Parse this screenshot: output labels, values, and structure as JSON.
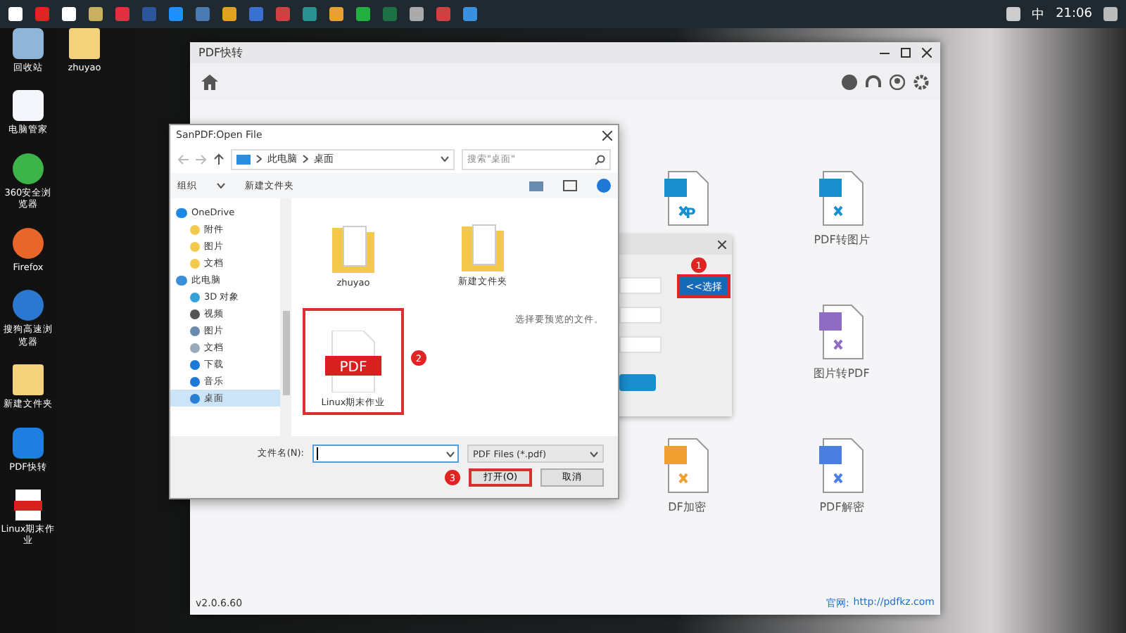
{
  "taskbar": {
    "ime": "中",
    "time": "21:06"
  },
  "desktop_icons": [
    {
      "label": "回收站",
      "kind": "bin"
    },
    {
      "label": "电脑管家",
      "kind": "app"
    },
    {
      "label": "360安全浏览器",
      "kind": "browser"
    },
    {
      "label": "Firefox",
      "kind": "firefox"
    },
    {
      "label": "搜狗高速浏览器",
      "kind": "sogou"
    },
    {
      "label": "新建文件夹",
      "kind": "folder"
    },
    {
      "label": "PDF快转",
      "kind": "cloud"
    },
    {
      "label": "Linux期末作业",
      "kind": "pdf"
    }
  ],
  "desktop_icons_column_2": [
    {
      "label": "zhuyao",
      "kind": "folder"
    }
  ],
  "app_window": {
    "title": "PDF快转",
    "version": "v2.0.6.60",
    "site_label": "官网:",
    "site_url": "http://pdfkz.com",
    "tools": [
      {
        "color": "#1a8fd0",
        "glyph": "P"
      },
      {
        "label": "PDF转图片",
        "color": "#1a8fd0"
      },
      {
        "label": "图片转PDF",
        "color": "#8e6cc4"
      },
      {
        "label": "DF加密",
        "color": "#f0a030"
      },
      {
        "label": "PDF解密",
        "color": "#4a7fe0"
      }
    ]
  },
  "select_dialog": {
    "badge": "1",
    "button": "<<选择"
  },
  "open_dialog": {
    "title": "SanPDF:Open File",
    "path": [
      "此电脑",
      "桌面"
    ],
    "search_placeholder": "搜索\"桌面\"",
    "organize": "组织",
    "new_folder": "新建文件夹",
    "nav": [
      {
        "label": "OneDrive",
        "kind": "cloud",
        "selected": false,
        "children": [
          {
            "label": "附件",
            "kind": "folder",
            "selected": false
          },
          {
            "label": "图片",
            "kind": "folder",
            "selected": false
          },
          {
            "label": "文档",
            "kind": "folder",
            "selected": false
          }
        ]
      },
      {
        "label": "此电脑",
        "kind": "pc",
        "selected": false,
        "children": [
          {
            "label": "3D 对象",
            "kind": "cube",
            "selected": false
          },
          {
            "label": "视频",
            "kind": "video",
            "selected": false
          },
          {
            "label": "图片",
            "kind": "image",
            "selected": false
          },
          {
            "label": "文档",
            "kind": "doc",
            "selected": false
          },
          {
            "label": "下载",
            "kind": "download",
            "selected": false
          },
          {
            "label": "音乐",
            "kind": "music",
            "selected": false
          },
          {
            "label": "桌面",
            "kind": "desktop",
            "selected": true
          }
        ]
      }
    ],
    "files": [
      {
        "label": "zhuyao",
        "kind": "folder",
        "highlighted": false
      },
      {
        "label": "新建文件夹",
        "kind": "folder",
        "highlighted": false
      },
      {
        "label": "Linux期末作业",
        "kind": "pdf",
        "highlighted": true,
        "badge": "2",
        "glyph": "PDF"
      }
    ],
    "preview_hint": "选择要预览的文件。",
    "filename_label": "文件名(N):",
    "filetype": "PDF Files (*.pdf)",
    "open_badge": "3",
    "open_button": "打开(O)",
    "cancel_button": "取消"
  }
}
